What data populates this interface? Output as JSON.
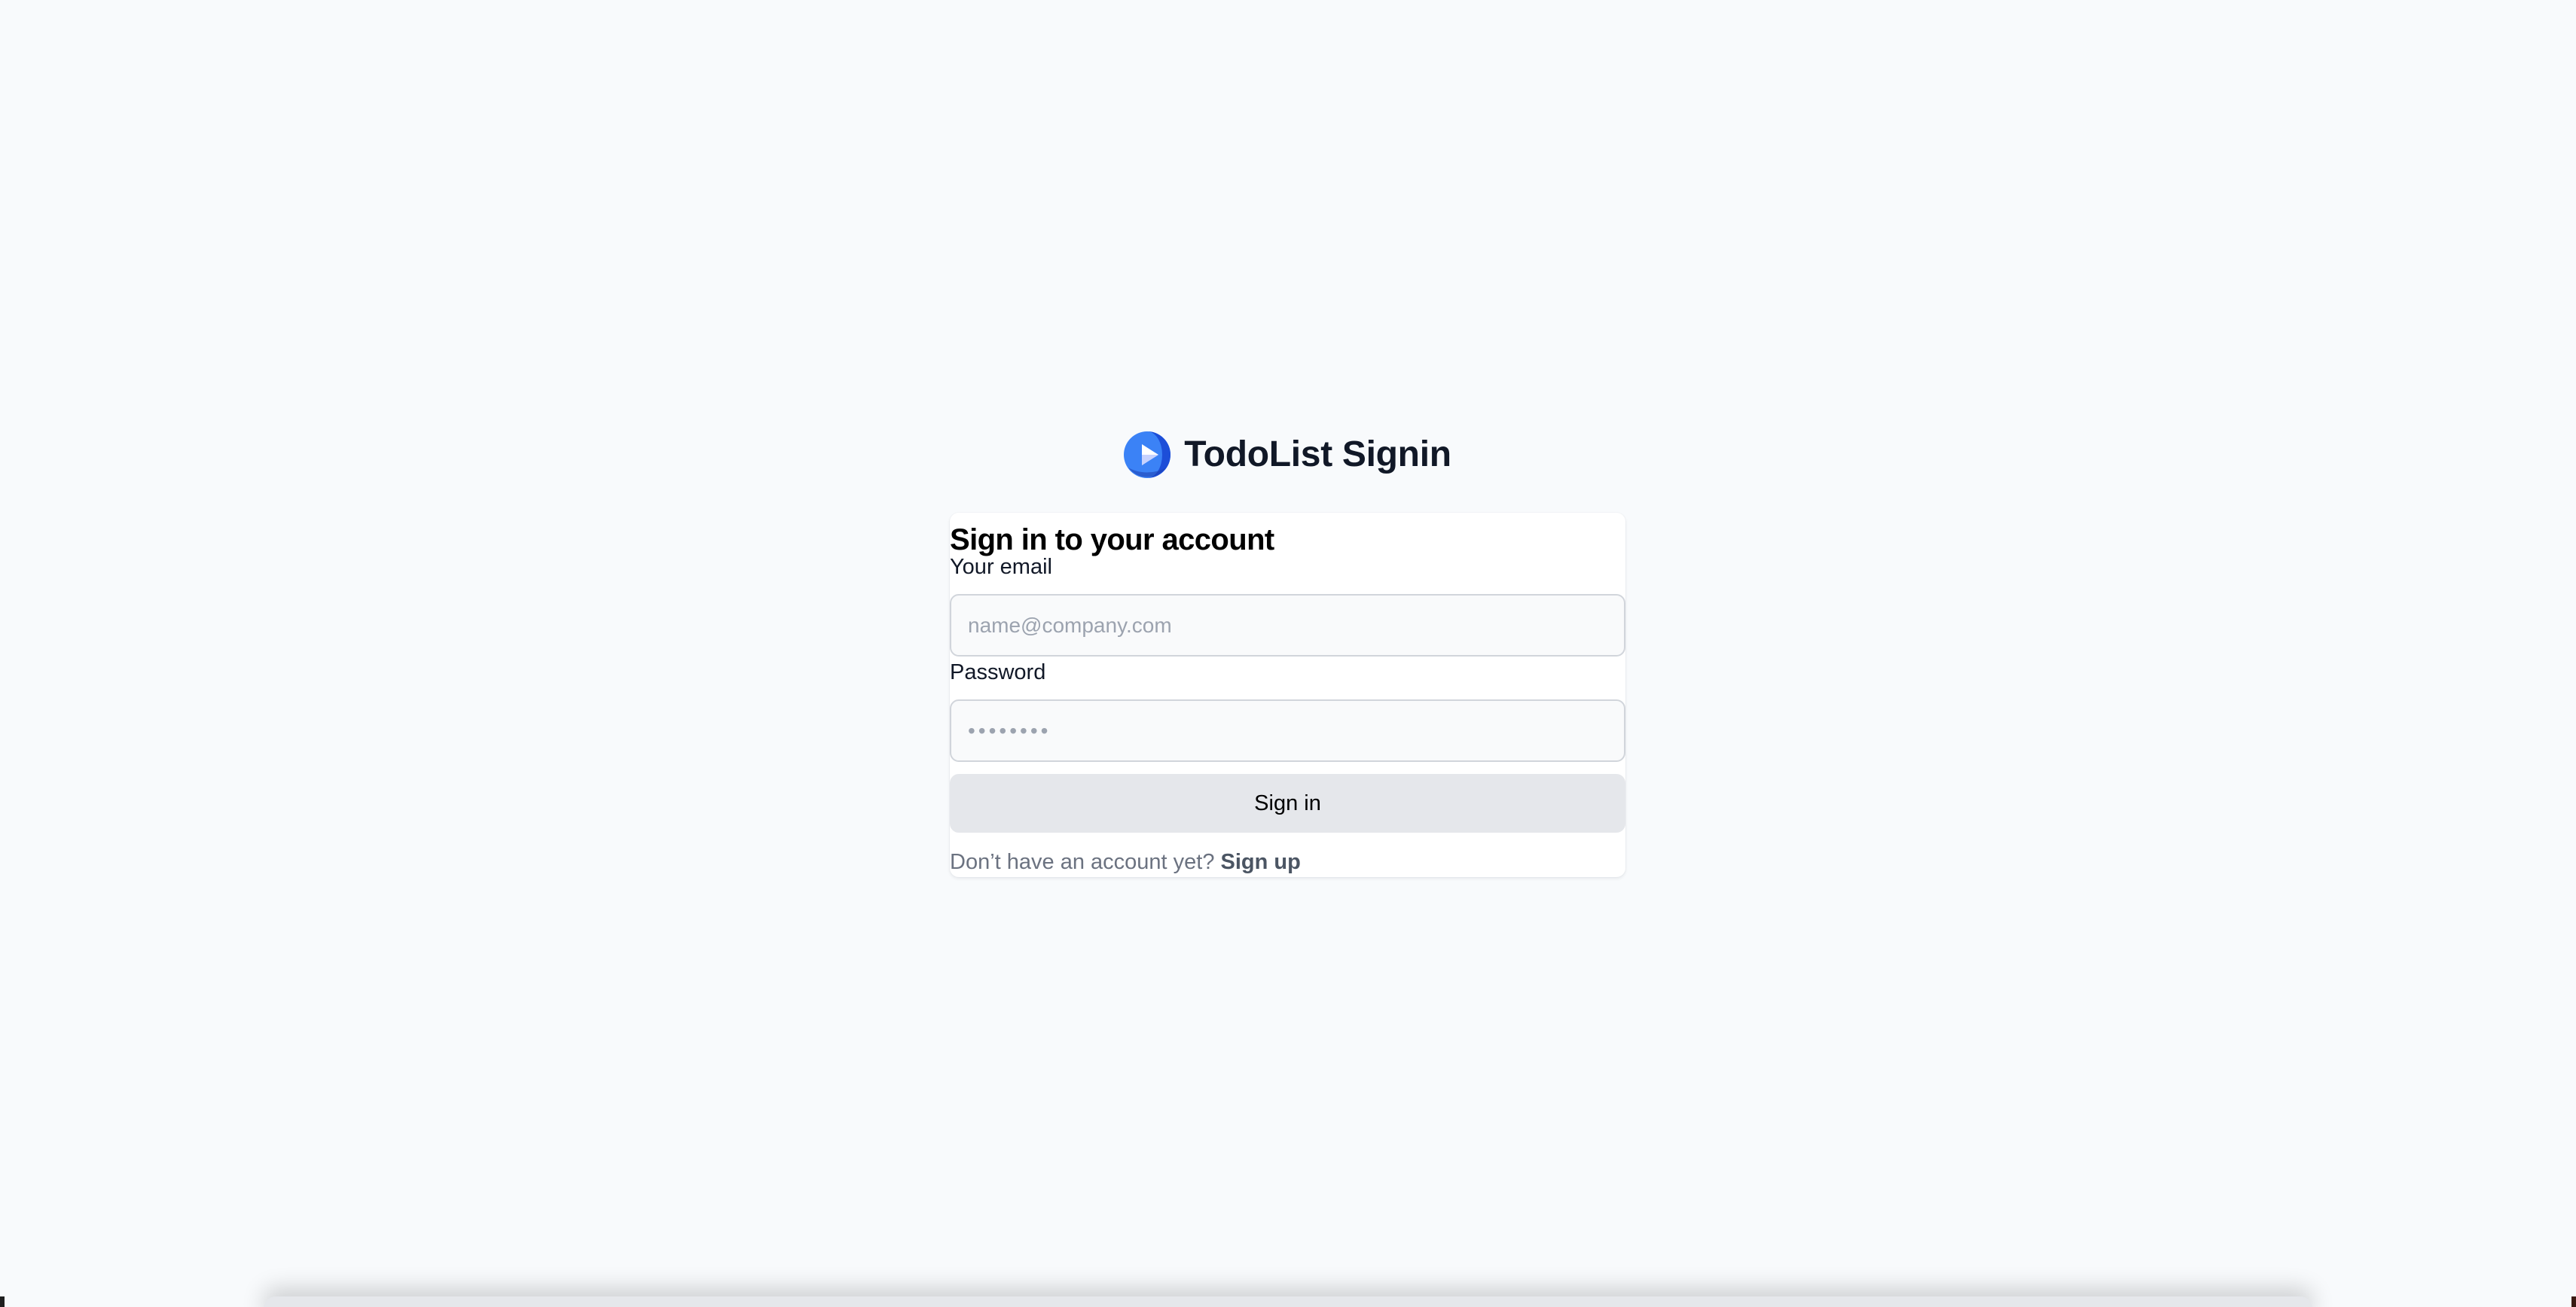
{
  "brand": {
    "title": "TodoList Signin",
    "logo_icon": "play-logo-icon",
    "accent_color": "#2563eb"
  },
  "form": {
    "heading": "Sign in to your account",
    "email": {
      "label": "Your email",
      "value": "",
      "placeholder": "name@company.com"
    },
    "password": {
      "label": "Password",
      "value": "",
      "placeholder": "••••••••"
    },
    "submit_label": "Sign in",
    "signup_prompt": "Don’t have an account yet?",
    "signup_link": "Sign up"
  }
}
